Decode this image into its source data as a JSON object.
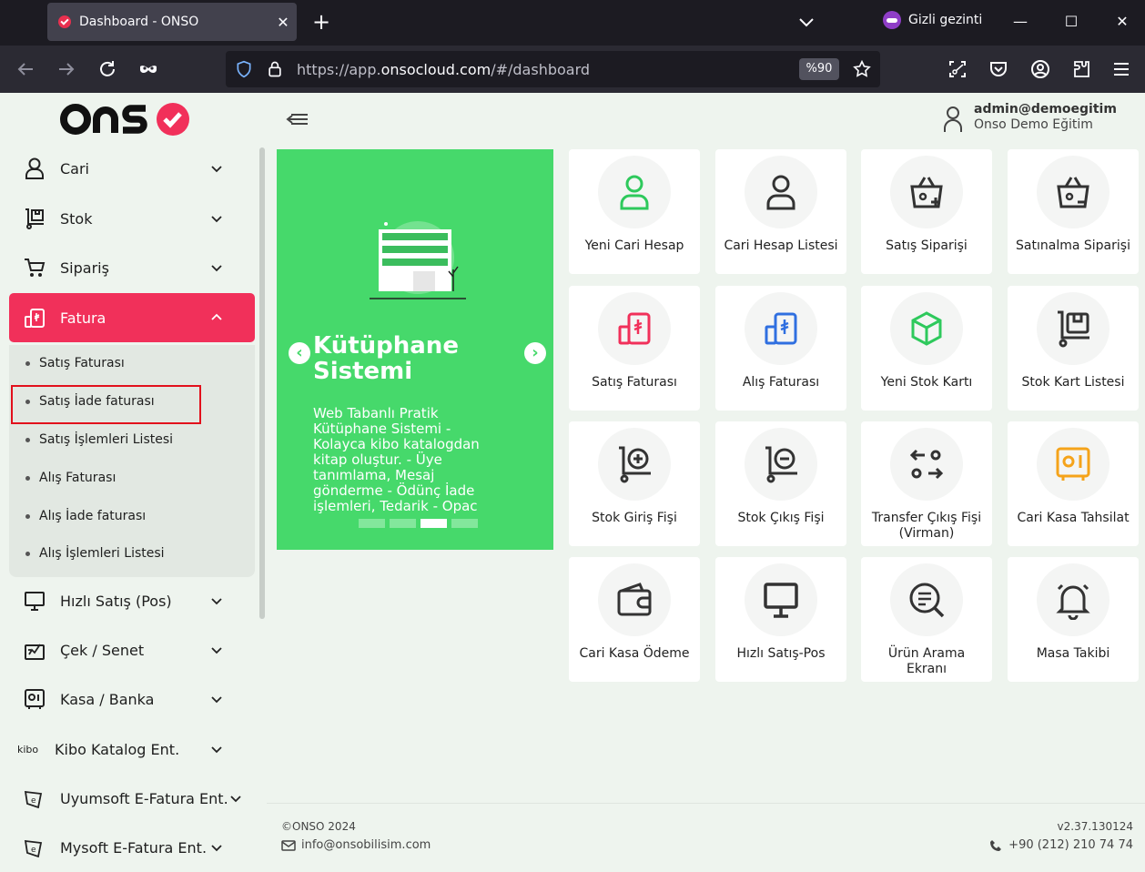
{
  "browser": {
    "tab_title": "Dashboard - ONSO",
    "private_label": "Gizli gezinti",
    "url_prefix": "https://app.",
    "url_domain": "onsocloud.com",
    "url_suffix": "/#/dashboard",
    "zoom": "%90"
  },
  "header": {
    "user_email": "admin@demoegitim",
    "user_org": "Onso Demo Eğitim"
  },
  "sidebar": {
    "items": [
      {
        "label": "Cari",
        "icon": "user-icon"
      },
      {
        "label": "Stok",
        "icon": "stock-icon"
      },
      {
        "label": "Sipariş",
        "icon": "cart-icon"
      },
      {
        "label": "Fatura",
        "icon": "invoice-icon"
      },
      {
        "label": "Hızlı Satış (Pos)",
        "icon": "monitor-icon"
      },
      {
        "label": "Çek / Senet",
        "icon": "cheque-icon"
      },
      {
        "label": "Kasa / Banka",
        "icon": "safe-icon"
      },
      {
        "label": "Kibo Katalog Ent.",
        "icon": "kibo-logo"
      },
      {
        "label": "Uyumsoft E-Fatura Ent.",
        "icon": "efatura-icon"
      },
      {
        "label": "Mysoft E-Fatura Ent.",
        "icon": "efatura-icon"
      }
    ],
    "kibo_text": "kibo",
    "fatura_sub": [
      "Satış Faturası",
      "Satış İade faturası",
      "Satış İşlemleri Listesi",
      "Alış Faturası",
      "Alış İade faturası",
      "Alış İşlemleri Listesi"
    ]
  },
  "banner": {
    "title": "Kütüphane Sistemi",
    "description": "Web Tabanlı Pratik Kütüphane Sistemi - Kolayca kibo katalogdan kitap oluştur. - Üye tanımlama, Mesaj gönderme - Ödünç İade işlemleri, Tedarik - Opac",
    "prev": "‹",
    "next": "›",
    "slides": 4,
    "active_slide": 3
  },
  "tiles": [
    {
      "label": "Yeni Cari Hesap",
      "icon": "user-icon",
      "color": "#2ec95c"
    },
    {
      "label": "Cari Hesap Listesi",
      "icon": "user-icon",
      "color": "#333333"
    },
    {
      "label": "Satış Siparişi",
      "icon": "basket-plus-icon",
      "color": "#333333"
    },
    {
      "label": "Satınalma Siparişi",
      "icon": "basket-minus-icon",
      "color": "#333333"
    },
    {
      "label": "Satış Faturası",
      "icon": "invoice-icon",
      "color": "#f1305a"
    },
    {
      "label": "Alış Faturası",
      "icon": "invoice-icon",
      "color": "#2f6fe0"
    },
    {
      "label": "Yeni Stok Kartı",
      "icon": "box-icon",
      "color": "#2ec95c"
    },
    {
      "label": "Stok Kart Listesi",
      "icon": "stock-icon",
      "color": "#333333"
    },
    {
      "label": "Stok Giriş Fişi",
      "icon": "stock-in-icon",
      "color": "#333333"
    },
    {
      "label": "Stok Çıkış Fişi",
      "icon": "stock-out-icon",
      "color": "#333333"
    },
    {
      "label": "Transfer Çıkış Fişi (Virman)",
      "icon": "transfer-icon",
      "color": "#333333"
    },
    {
      "label": "Cari Kasa Tahsilat",
      "icon": "safe-icon",
      "color": "#f5a31a"
    },
    {
      "label": "Cari Kasa Ödeme",
      "icon": "wallet-icon",
      "color": "#333333"
    },
    {
      "label": "Hızlı Satış-Pos",
      "icon": "monitor-icon",
      "color": "#333333"
    },
    {
      "label": "Ürün Arama Ekranı",
      "icon": "search-doc-icon",
      "color": "#333333"
    },
    {
      "label": "Masa Takibi",
      "icon": "bell-icon",
      "color": "#333333"
    }
  ],
  "footer": {
    "copyright": "©ONSO 2024",
    "email": "info@onsobilisim.com",
    "version": "v2.37.130124",
    "phone": "+90 (212) 210 74 74"
  },
  "colors": {
    "accent": "#f1305a",
    "banner": "#46d96b",
    "background": "#eef4ee"
  }
}
